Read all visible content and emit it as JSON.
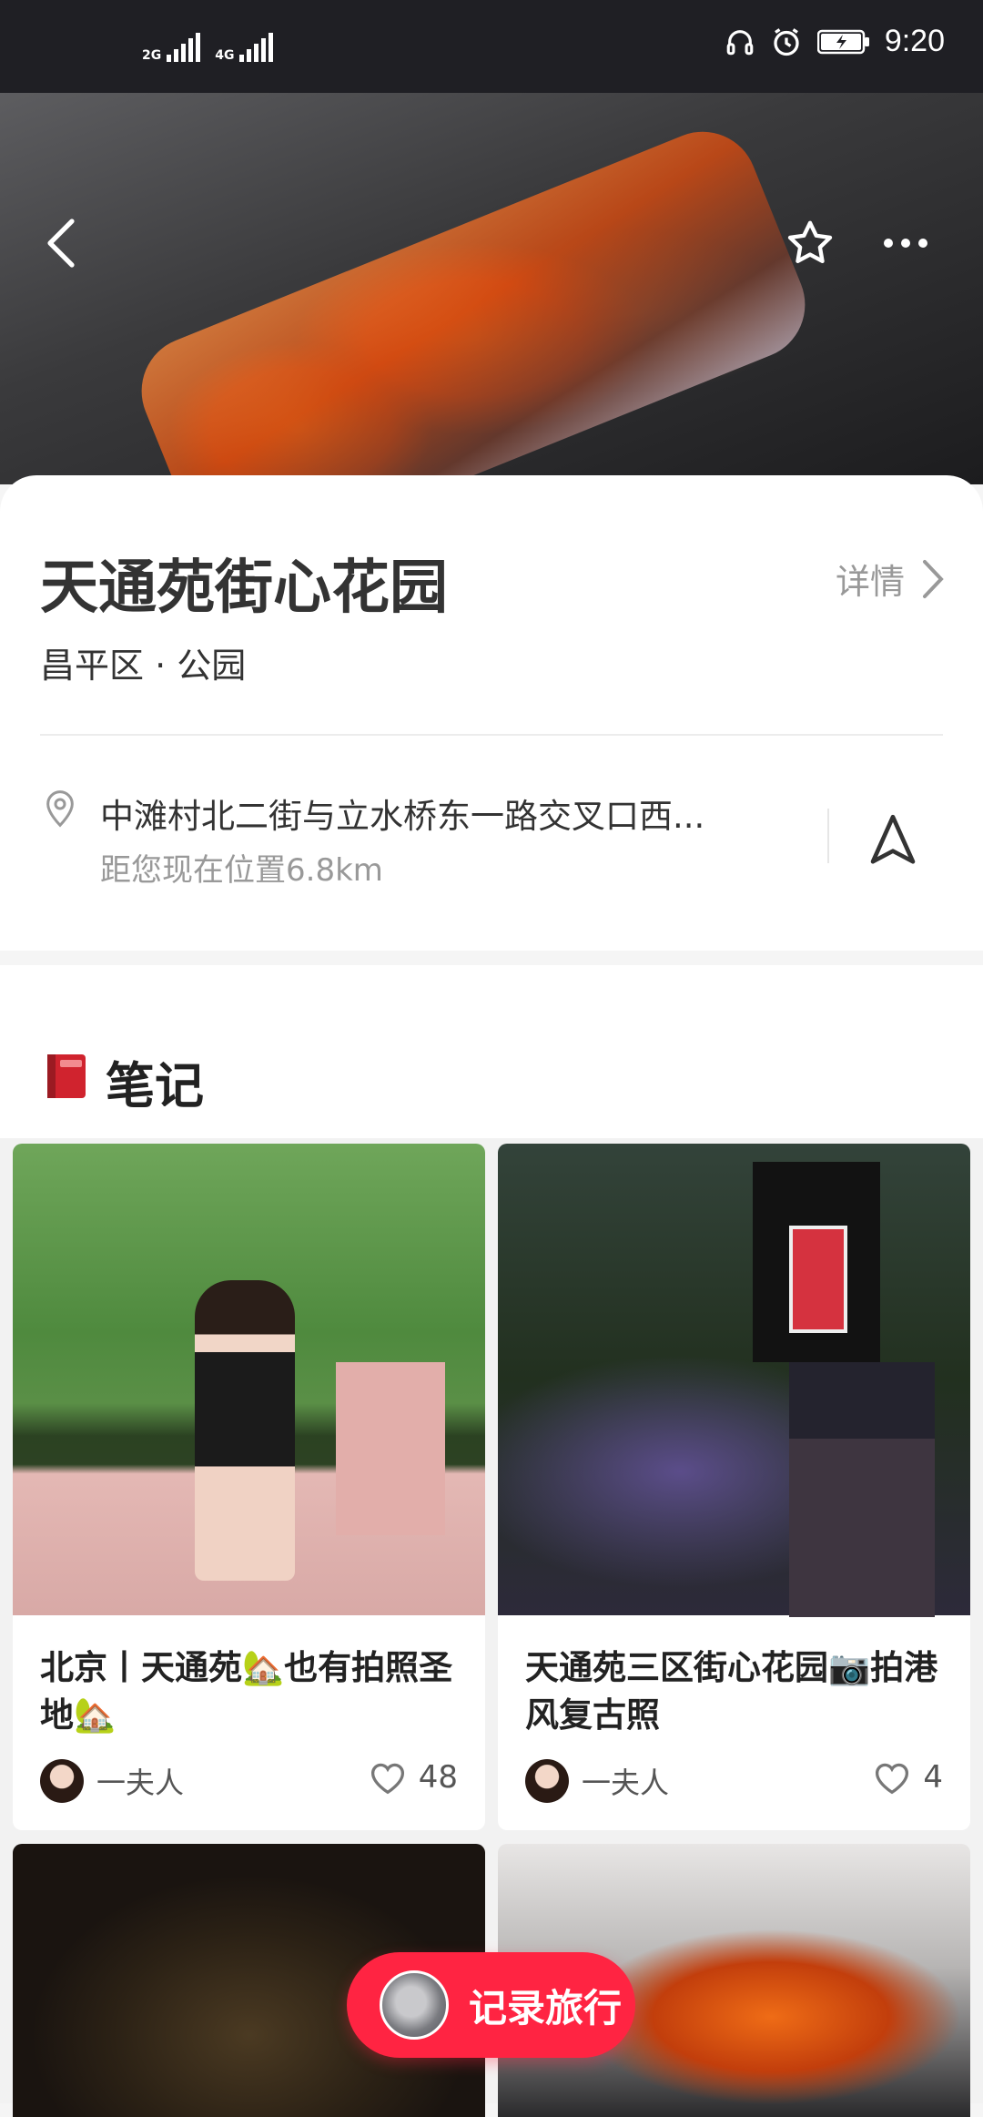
{
  "status_bar": {
    "net1": "2G",
    "net2": "4G",
    "time": "9:20"
  },
  "place": {
    "title": "天通苑街心花园",
    "subtitle": "昌平区 · 公园",
    "detail_label": "详情",
    "address": "中滩村北二街与立水桥东一路交叉口西...",
    "distance": "距您现在位置6.8km"
  },
  "notes": {
    "section_title": "笔记",
    "items": [
      {
        "title": "北京丨天通苑🏡也有拍照圣地🏡",
        "author": "一夫人",
        "likes": "48"
      },
      {
        "title": "天通苑三区街心花园📷拍港风复古照",
        "author": "一夫人",
        "likes": "4"
      }
    ]
  },
  "fab": {
    "label": "记录旅行"
  },
  "colors": {
    "accent": "#ff2442",
    "text_primary": "#333333",
    "text_secondary": "#999999"
  }
}
